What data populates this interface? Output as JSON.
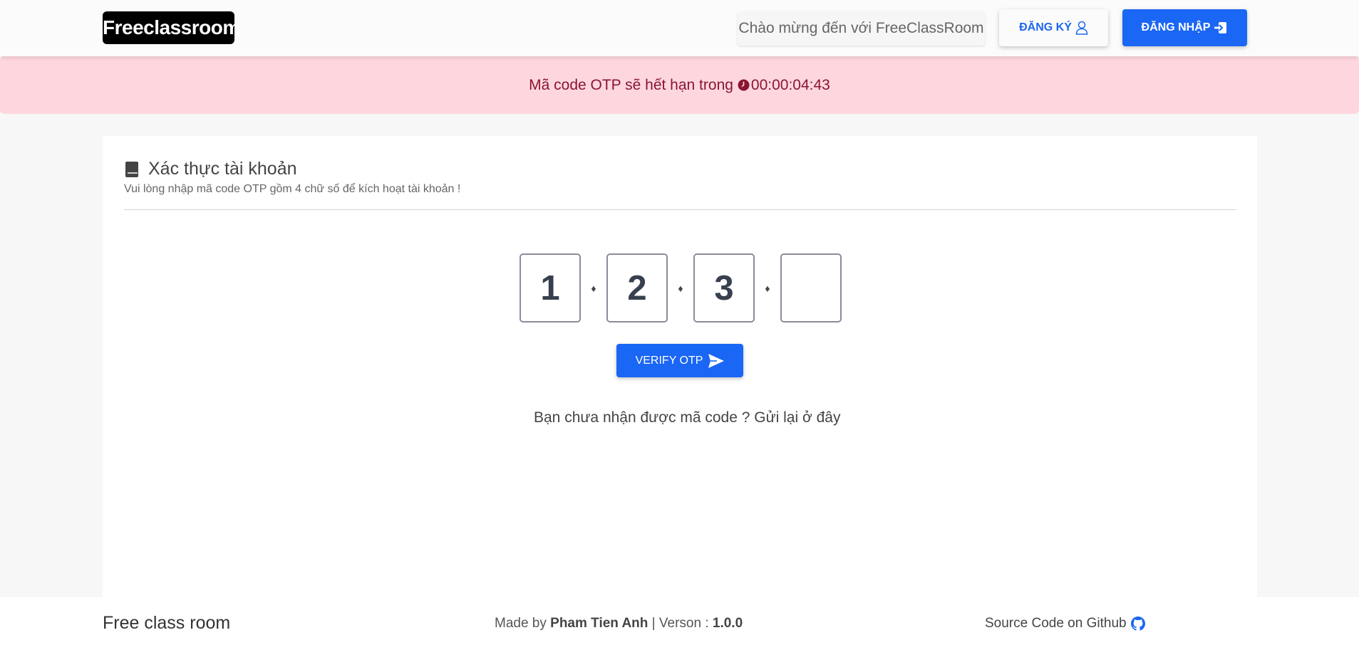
{
  "navbar": {
    "logo": "Freeclassroom",
    "welcome": "Chào mừng đến với FreeClassRoom",
    "register_label": "ĐĂNG KÝ",
    "login_label": "ĐĂNG NHẬP"
  },
  "alert": {
    "message": "Mã code OTP sẽ hết hạn trong",
    "countdown": "00:00:04:43",
    "color": "#fed7de"
  },
  "card": {
    "title": "Xác thực tài khoản",
    "subtitle": "Vui lòng nhập mã code OTP gồm 4 chữ số để kích hoạt tài khoản !",
    "otp_digits": [
      "1",
      "2",
      "3",
      ""
    ],
    "separator": "♦",
    "verify_label": "VERIFY OTP",
    "resend_prefix": "Bạn chưa nhận được mã code ? ",
    "resend_link": "Gửi lại ở đây"
  },
  "footer": {
    "left": "Free class room",
    "made_by_prefix": "Made by ",
    "author": "Pham Tien Anh",
    "version_prefix": " | Verson : ",
    "version": "1.0.0",
    "source_label": "Source Code on Github"
  },
  "colors": {
    "primary": "#1a66f5",
    "alert_text": "#8a1530"
  },
  "icons": {
    "register": "user-icon",
    "login": "sign-in-icon",
    "clock": "clock-icon",
    "title": "book-icon",
    "verify": "send-icon",
    "github": "github-icon"
  }
}
